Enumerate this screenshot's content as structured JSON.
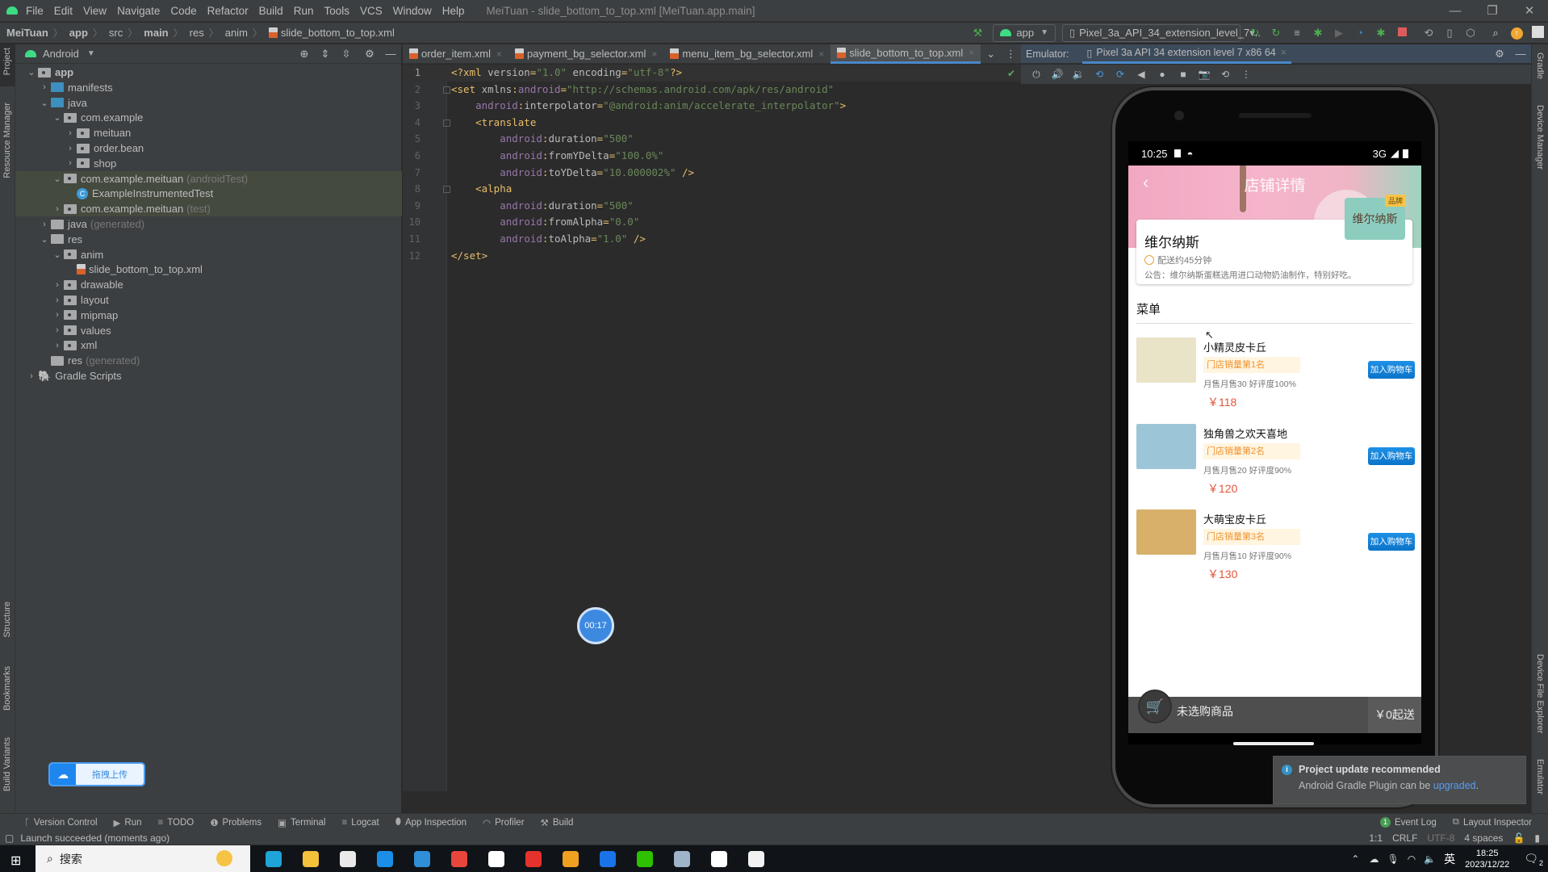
{
  "window": {
    "menu": [
      "File",
      "Edit",
      "View",
      "Navigate",
      "Code",
      "Refactor",
      "Build",
      "Run",
      "Tools",
      "VCS",
      "Window",
      "Help"
    ],
    "title": "MeiTuan - slide_bottom_to_top.xml [MeiTuan.app.main]",
    "controls": {
      "minimize": "—",
      "restore": "❐",
      "close": "✕"
    }
  },
  "breadcrumb": [
    "MeiTuan",
    "app",
    "src",
    "main",
    "res",
    "anim",
    "slide_bottom_to_top.xml"
  ],
  "toolbar": {
    "run_config": "app",
    "device": "Pixel_3a_API_34_extension_level_7▾..",
    "icons": [
      "hammer-icon",
      "rerun-icon",
      "apply-changes-icon",
      "apply-code-changes-icon",
      "debug-icon",
      "attach-debugger-icon",
      "profile-icon",
      "attach-icon",
      "stop-icon",
      "sync-gradle-icon",
      "device-manager-icon",
      "sdk-manager-icon",
      "search-icon",
      "update-icon",
      "avatar"
    ]
  },
  "left_stripe": {
    "project": "Project",
    "resource_manager": "Resource Manager",
    "structure": "Structure",
    "bookmarks": "Bookmarks",
    "build_variants": "Build Variants"
  },
  "right_stripe": {
    "gradle": "Gradle",
    "device_manager": "Device Manager",
    "device_file_explorer": "Device File Explorer",
    "emulator": "Emulator"
  },
  "project": {
    "view": "Android",
    "tree": [
      {
        "label": "app",
        "depth": 0,
        "expanded": true,
        "icon": "module"
      },
      {
        "label": "manifests",
        "depth": 1,
        "expanded": false,
        "icon": "blue"
      },
      {
        "label": "java",
        "depth": 1,
        "expanded": true,
        "icon": "blue"
      },
      {
        "label": "com.example",
        "depth": 2,
        "expanded": true,
        "icon": "pkg"
      },
      {
        "label": "meituan",
        "depth": 3,
        "expanded": false,
        "icon": "pkg"
      },
      {
        "label": "order.bean",
        "depth": 3,
        "expanded": false,
        "icon": "pkg"
      },
      {
        "label": "shop",
        "depth": 3,
        "expanded": false,
        "icon": "pkg"
      },
      {
        "label": "com.example.meituan",
        "suffix": "(androidTest)",
        "depth": 2,
        "expanded": true,
        "icon": "pkg",
        "highlight": true
      },
      {
        "label": "ExampleInstrumentedTest",
        "depth": 3,
        "icon": "class",
        "highlight": true
      },
      {
        "label": "com.example.meituan",
        "suffix": "(test)",
        "depth": 2,
        "expanded": false,
        "icon": "pkg",
        "highlight": true
      },
      {
        "label": "java",
        "suffix": "(generated)",
        "depth": 1,
        "expanded": false,
        "icon": "gen"
      },
      {
        "label": "res",
        "depth": 1,
        "expanded": true,
        "icon": "res"
      },
      {
        "label": "anim",
        "depth": 2,
        "expanded": true,
        "icon": "pkg"
      },
      {
        "label": "slide_bottom_to_top.xml",
        "depth": 3,
        "icon": "xml"
      },
      {
        "label": "drawable",
        "depth": 2,
        "expanded": false,
        "icon": "pkg"
      },
      {
        "label": "layout",
        "depth": 2,
        "expanded": false,
        "icon": "pkg"
      },
      {
        "label": "mipmap",
        "depth": 2,
        "expanded": false,
        "icon": "pkg"
      },
      {
        "label": "values",
        "depth": 2,
        "expanded": false,
        "icon": "pkg"
      },
      {
        "label": "xml",
        "depth": 2,
        "expanded": false,
        "icon": "pkg"
      },
      {
        "label": "res",
        "suffix": "(generated)",
        "depth": 1,
        "icon": "res"
      },
      {
        "label": "Gradle Scripts",
        "depth": 0,
        "expanded": false,
        "icon": "gradle"
      }
    ]
  },
  "editor": {
    "tabs": [
      {
        "label": "order_item.xml",
        "active": false
      },
      {
        "label": "payment_bg_selector.xml",
        "active": false
      },
      {
        "label": "menu_item_bg_selector.xml",
        "active": false
      },
      {
        "label": "slide_bottom_to_top.xml",
        "active": true
      }
    ],
    "lines": [
      "<?xml version=\"1.0\" encoding=\"utf-8\"?>",
      "<set xmlns:android=\"http://schemas.android.com/apk/res/android\"",
      "    android:interpolator=\"@android:anim/accelerate_interpolator\">",
      "    <translate",
      "        android:duration=\"500\"",
      "        android:fromYDelta=\"100.0%\"",
      "        android:toYDelta=\"10.000002%\" />",
      "    <alpha",
      "        android:duration=\"500\"",
      "        android:fromAlpha=\"0.0\"",
      "        android:toAlpha=\"1.0\" />",
      "</set>"
    ]
  },
  "timer": "00:17",
  "upload_widget": {
    "label": "拖拽上传"
  },
  "emulator": {
    "label": "Emulator:",
    "device_tab": "Pixel 3a API 34 extension level 7 x86 64",
    "controls": [
      "power-icon",
      "volume-up-icon",
      "volume-down-icon",
      "rotate-left-icon",
      "rotate-right-icon",
      "back-icon",
      "home-icon",
      "overview-icon",
      "screenshot-icon",
      "snapshot-icon",
      "more-icon"
    ]
  },
  "phone": {
    "status": {
      "time": "10:25",
      "network": "3G"
    },
    "page_title": "店铺详情",
    "shop": {
      "name": "维尔纳斯",
      "delivery": "配送约45分钟",
      "notice": "公告：维尔纳斯蛋糕选用进口动物奶油制作，特别好吃。",
      "brand_tag": "品牌",
      "logo_text": "维尔纳斯"
    },
    "menu_title": "菜单",
    "items": [
      {
        "name": "小精灵皮卡丘",
        "rank": "门店销量第1名",
        "sales": "月售月售30 好评度100%",
        "price": "￥118",
        "button": "加入购物车",
        "thumb": "#e9e3c8"
      },
      {
        "name": "独角兽之欢天喜地",
        "rank": "门店销量第2名",
        "sales": "月售月售20 好评度90%",
        "price": "￥120",
        "button": "加入购物车",
        "thumb": "#9cc6d8"
      },
      {
        "name": "大萌宝皮卡丘",
        "rank": "门店销量第3名",
        "sales": "月售月售10 好评度90%",
        "price": "￥130",
        "button": "加入购物车",
        "thumb": "#d8b06a"
      }
    ],
    "cart": {
      "empty_label": "未选购商品",
      "min_order": "￥0起送"
    }
  },
  "notification": {
    "title": "Project update recommended",
    "body_prefix": "Android Gradle Plugin can be ",
    "link": "upgraded",
    "body_suffix": "."
  },
  "tool_windows": [
    "Version Control",
    "Run",
    "TODO",
    "Problems",
    "Terminal",
    "Logcat",
    "App Inspection",
    "Profiler",
    "Build"
  ],
  "tool_windows_right": {
    "event_log": "Event Log",
    "event_count": "1",
    "layout_inspector": "Layout Inspector"
  },
  "status": {
    "message": "Launch succeeded (moments ago)",
    "position": "1:1",
    "line_sep": "CRLF",
    "encoding": "UTF-8",
    "indent": "4 spaces"
  },
  "taskbar": {
    "search_placeholder": "搜索",
    "time": "18:25",
    "date": "2023/12/22",
    "ime": "英",
    "notifications": "2"
  }
}
